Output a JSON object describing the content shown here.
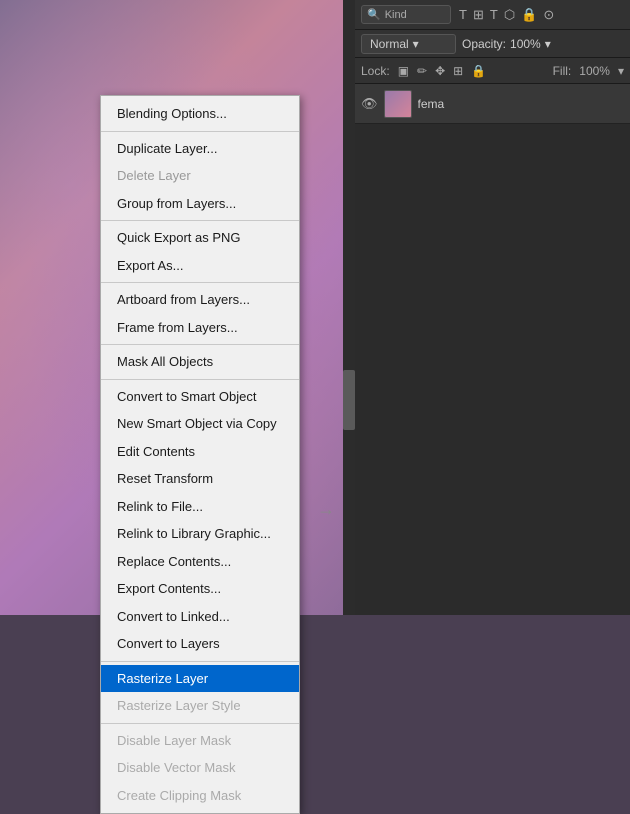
{
  "panel": {
    "search_placeholder": "Kind",
    "blend_mode": "Normal",
    "opacity_label": "Opacity:",
    "opacity_value": "100%",
    "lock_label": "Lock:",
    "fill_label": "Fill:",
    "fill_value": "100%",
    "layer_name": "fema"
  },
  "toolbar": {
    "icons": [
      "T",
      "⊞",
      "⊟",
      "🔒",
      "⊙"
    ]
  },
  "context_menu": {
    "items": [
      {
        "id": "blending-options",
        "label": "Blending Options...",
        "type": "normal"
      },
      {
        "id": "sep1",
        "type": "separator"
      },
      {
        "id": "duplicate-layer",
        "label": "Duplicate Layer...",
        "type": "normal"
      },
      {
        "id": "delete-layer",
        "label": "Delete Layer",
        "type": "disabled"
      },
      {
        "id": "group-from-layers",
        "label": "Group from Layers...",
        "type": "normal"
      },
      {
        "id": "sep2",
        "type": "separator"
      },
      {
        "id": "quick-export",
        "label": "Quick Export as PNG",
        "type": "normal"
      },
      {
        "id": "export-as",
        "label": "Export As...",
        "type": "normal"
      },
      {
        "id": "sep3",
        "type": "separator"
      },
      {
        "id": "artboard-from-layers",
        "label": "Artboard from Layers...",
        "type": "normal"
      },
      {
        "id": "frame-from-layers",
        "label": "Frame from Layers...",
        "type": "normal"
      },
      {
        "id": "sep4",
        "type": "separator"
      },
      {
        "id": "mask-all-objects",
        "label": "Mask All Objects",
        "type": "normal"
      },
      {
        "id": "sep5",
        "type": "separator"
      },
      {
        "id": "convert-to-smart-object",
        "label": "Convert to Smart Object",
        "type": "normal"
      },
      {
        "id": "new-smart-object-via-copy",
        "label": "New Smart Object via Copy",
        "type": "normal"
      },
      {
        "id": "edit-contents",
        "label": "Edit Contents",
        "type": "normal"
      },
      {
        "id": "reset-transform",
        "label": "Reset Transform",
        "type": "normal"
      },
      {
        "id": "relink-to-file",
        "label": "Relink to File...",
        "type": "normal"
      },
      {
        "id": "relink-to-library-graphic",
        "label": "Relink to Library Graphic...",
        "type": "normal"
      },
      {
        "id": "replace-contents",
        "label": "Replace Contents...",
        "type": "normal"
      },
      {
        "id": "export-contents",
        "label": "Export Contents...",
        "type": "normal"
      },
      {
        "id": "convert-to-linked",
        "label": "Convert to Linked...",
        "type": "normal"
      },
      {
        "id": "convert-to-layers",
        "label": "Convert to Layers",
        "type": "normal"
      },
      {
        "id": "sep6",
        "type": "separator"
      },
      {
        "id": "rasterize-layer",
        "label": "Rasterize Layer",
        "type": "highlighted"
      },
      {
        "id": "rasterize-layer-style",
        "label": "Rasterize Layer Style",
        "type": "grayed"
      },
      {
        "id": "sep7",
        "type": "separator"
      },
      {
        "id": "disable-layer-mask",
        "label": "Disable Layer Mask",
        "type": "grayed"
      },
      {
        "id": "disable-vector-mask",
        "label": "Disable Vector Mask",
        "type": "grayed"
      },
      {
        "id": "create-clipping-mask",
        "label": "Create Clipping Mask",
        "type": "grayed"
      }
    ]
  }
}
